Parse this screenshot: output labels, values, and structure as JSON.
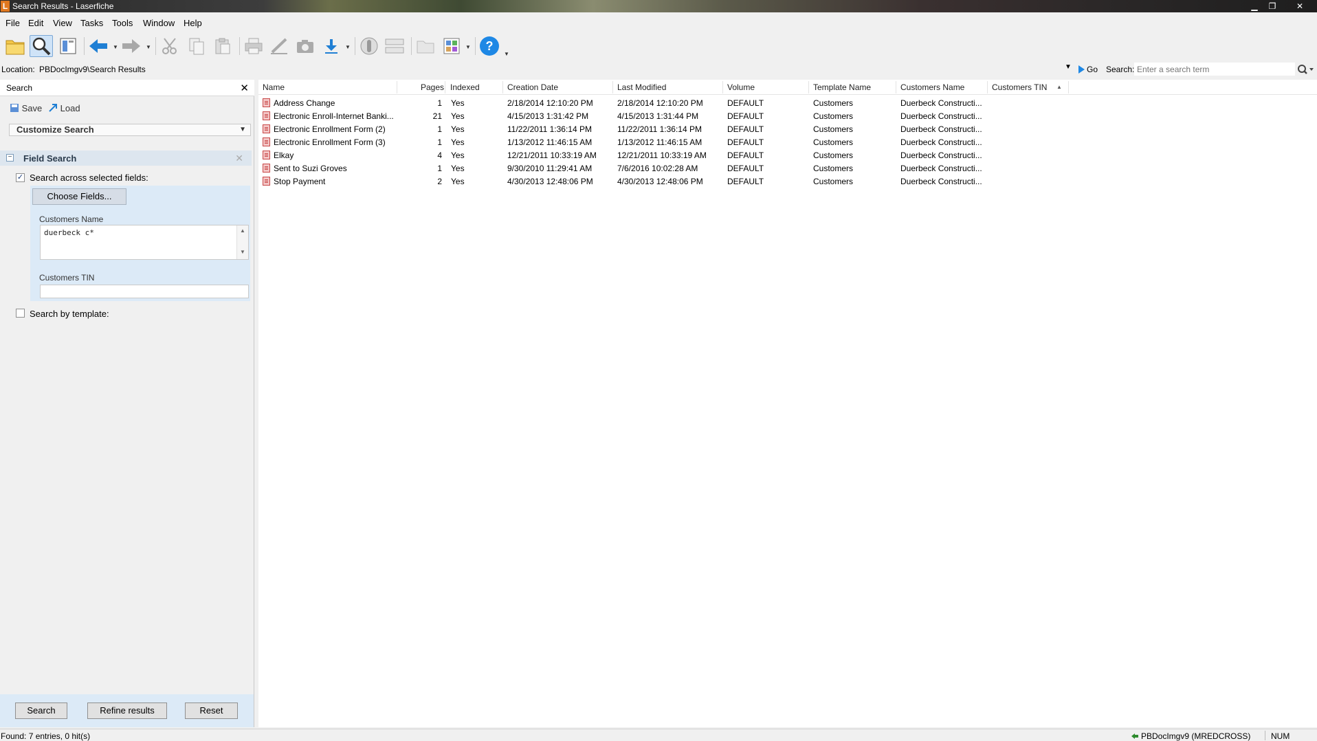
{
  "window": {
    "logo_letter": "L",
    "title": "Search Results - Laserfiche",
    "minimize": "▁",
    "restore": "❐",
    "close": "✕"
  },
  "menu": [
    "File",
    "Edit",
    "View",
    "Tasks",
    "Tools",
    "Window",
    "Help"
  ],
  "toolbar": {
    "icons": [
      "open-folder-icon",
      "search-icon",
      "browse-pane-icon",
      "back-arrow-icon",
      "forward-arrow-icon",
      "cut-icon",
      "copy-icon",
      "paste-icon",
      "print-icon",
      "pen-icon",
      "camera-icon",
      "download-icon",
      "zoom-icon",
      "thumbnails-icon",
      "new-folder-icon",
      "view-mode-icon",
      "help-icon"
    ],
    "help_glyph": "?"
  },
  "location": {
    "label": "Location:",
    "path": "PBDocImgv9\\Search Results",
    "go_label": "Go",
    "search_label": "Search:",
    "search_placeholder": "Enter a search term"
  },
  "search_pane": {
    "title": "Search",
    "save_label": "Save",
    "load_label": "Load",
    "customize_label": "Customize Search",
    "field_search": {
      "title": "Field Search",
      "toggle": "−",
      "across_label": "Search across selected fields:",
      "across_checked": true,
      "choose_fields_label": "Choose Fields...",
      "fields": [
        {
          "label": "Customers Name",
          "value": "duerbeck c*"
        },
        {
          "label": "Customers TIN",
          "value": ""
        }
      ]
    },
    "template_label": "Search by template:",
    "template_checked": false,
    "buttons": {
      "search": "Search",
      "refine": "Refine results",
      "reset": "Reset"
    }
  },
  "results": {
    "columns": [
      "Name",
      "Pages",
      "Indexed",
      "Creation Date",
      "Last Modified",
      "Volume",
      "Template Name",
      "Customers Name",
      "Customers TIN"
    ],
    "rows": [
      {
        "name": "Address Change",
        "pages": "1",
        "indexed": "Yes",
        "created": "2/18/2014 12:10:20 PM",
        "modified": "2/18/2014 12:10:20 PM",
        "volume": "DEFAULT",
        "template": "Customers",
        "customer": "Duerbeck Constructi...",
        "tin": ""
      },
      {
        "name": "Electronic Enroll-Internet Banki...",
        "pages": "21",
        "indexed": "Yes",
        "created": "4/15/2013 1:31:42 PM",
        "modified": "4/15/2013 1:31:44 PM",
        "volume": "DEFAULT",
        "template": "Customers",
        "customer": "Duerbeck Constructi...",
        "tin": ""
      },
      {
        "name": "Electronic Enrollment Form (2)",
        "pages": "1",
        "indexed": "Yes",
        "created": "11/22/2011 1:36:14 PM",
        "modified": "11/22/2011 1:36:14 PM",
        "volume": "DEFAULT",
        "template": "Customers",
        "customer": "Duerbeck Constructi...",
        "tin": ""
      },
      {
        "name": "Electronic Enrollment Form (3)",
        "pages": "1",
        "indexed": "Yes",
        "created": "1/13/2012 11:46:15 AM",
        "modified": "1/13/2012 11:46:15 AM",
        "volume": "DEFAULT",
        "template": "Customers",
        "customer": "Duerbeck Constructi...",
        "tin": ""
      },
      {
        "name": "Elkay",
        "pages": "4",
        "indexed": "Yes",
        "created": "12/21/2011 10:33:19 AM",
        "modified": "12/21/2011 10:33:19 AM",
        "volume": "DEFAULT",
        "template": "Customers",
        "customer": "Duerbeck Constructi...",
        "tin": ""
      },
      {
        "name": "Sent to Suzi Groves",
        "pages": "1",
        "indexed": "Yes",
        "created": "9/30/2010 11:29:41 AM",
        "modified": "7/6/2016 10:02:28 AM",
        "volume": "DEFAULT",
        "template": "Customers",
        "customer": "Duerbeck Constructi...",
        "tin": ""
      },
      {
        "name": "Stop Payment",
        "pages": "2",
        "indexed": "Yes",
        "created": "4/30/2013 12:48:06 PM",
        "modified": "4/30/2013 12:48:06 PM",
        "volume": "DEFAULT",
        "template": "Customers",
        "customer": "Duerbeck Constructi...",
        "tin": ""
      }
    ]
  },
  "status": {
    "found": "Found: 7 entries, 0 hit(s)",
    "connection": "PBDocImgv9 (MREDCROSS)",
    "num": "NUM"
  },
  "colors": {
    "accent": "#1e88e5",
    "panel_blue": "#dceaf7",
    "doc_red": "#c84848"
  }
}
